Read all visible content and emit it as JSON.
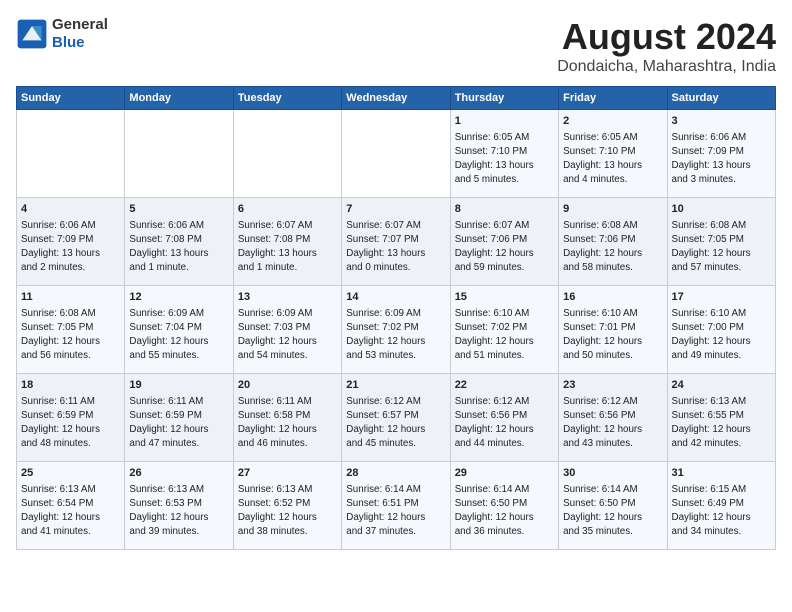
{
  "header": {
    "logo": {
      "general": "General",
      "blue": "Blue"
    },
    "title": "August 2024",
    "subtitle": "Dondaicha, Maharashtra, India"
  },
  "weekdays": [
    "Sunday",
    "Monday",
    "Tuesday",
    "Wednesday",
    "Thursday",
    "Friday",
    "Saturday"
  ],
  "weeks": [
    [
      {
        "day": "",
        "detail": ""
      },
      {
        "day": "",
        "detail": ""
      },
      {
        "day": "",
        "detail": ""
      },
      {
        "day": "",
        "detail": ""
      },
      {
        "day": "1",
        "detail": "Sunrise: 6:05 AM\nSunset: 7:10 PM\nDaylight: 13 hours\nand 5 minutes."
      },
      {
        "day": "2",
        "detail": "Sunrise: 6:05 AM\nSunset: 7:10 PM\nDaylight: 13 hours\nand 4 minutes."
      },
      {
        "day": "3",
        "detail": "Sunrise: 6:06 AM\nSunset: 7:09 PM\nDaylight: 13 hours\nand 3 minutes."
      }
    ],
    [
      {
        "day": "4",
        "detail": "Sunrise: 6:06 AM\nSunset: 7:09 PM\nDaylight: 13 hours\nand 2 minutes."
      },
      {
        "day": "5",
        "detail": "Sunrise: 6:06 AM\nSunset: 7:08 PM\nDaylight: 13 hours\nand 1 minute."
      },
      {
        "day": "6",
        "detail": "Sunrise: 6:07 AM\nSunset: 7:08 PM\nDaylight: 13 hours\nand 1 minute."
      },
      {
        "day": "7",
        "detail": "Sunrise: 6:07 AM\nSunset: 7:07 PM\nDaylight: 13 hours\nand 0 minutes."
      },
      {
        "day": "8",
        "detail": "Sunrise: 6:07 AM\nSunset: 7:06 PM\nDaylight: 12 hours\nand 59 minutes."
      },
      {
        "day": "9",
        "detail": "Sunrise: 6:08 AM\nSunset: 7:06 PM\nDaylight: 12 hours\nand 58 minutes."
      },
      {
        "day": "10",
        "detail": "Sunrise: 6:08 AM\nSunset: 7:05 PM\nDaylight: 12 hours\nand 57 minutes."
      }
    ],
    [
      {
        "day": "11",
        "detail": "Sunrise: 6:08 AM\nSunset: 7:05 PM\nDaylight: 12 hours\nand 56 minutes."
      },
      {
        "day": "12",
        "detail": "Sunrise: 6:09 AM\nSunset: 7:04 PM\nDaylight: 12 hours\nand 55 minutes."
      },
      {
        "day": "13",
        "detail": "Sunrise: 6:09 AM\nSunset: 7:03 PM\nDaylight: 12 hours\nand 54 minutes."
      },
      {
        "day": "14",
        "detail": "Sunrise: 6:09 AM\nSunset: 7:02 PM\nDaylight: 12 hours\nand 53 minutes."
      },
      {
        "day": "15",
        "detail": "Sunrise: 6:10 AM\nSunset: 7:02 PM\nDaylight: 12 hours\nand 51 minutes."
      },
      {
        "day": "16",
        "detail": "Sunrise: 6:10 AM\nSunset: 7:01 PM\nDaylight: 12 hours\nand 50 minutes."
      },
      {
        "day": "17",
        "detail": "Sunrise: 6:10 AM\nSunset: 7:00 PM\nDaylight: 12 hours\nand 49 minutes."
      }
    ],
    [
      {
        "day": "18",
        "detail": "Sunrise: 6:11 AM\nSunset: 6:59 PM\nDaylight: 12 hours\nand 48 minutes."
      },
      {
        "day": "19",
        "detail": "Sunrise: 6:11 AM\nSunset: 6:59 PM\nDaylight: 12 hours\nand 47 minutes."
      },
      {
        "day": "20",
        "detail": "Sunrise: 6:11 AM\nSunset: 6:58 PM\nDaylight: 12 hours\nand 46 minutes."
      },
      {
        "day": "21",
        "detail": "Sunrise: 6:12 AM\nSunset: 6:57 PM\nDaylight: 12 hours\nand 45 minutes."
      },
      {
        "day": "22",
        "detail": "Sunrise: 6:12 AM\nSunset: 6:56 PM\nDaylight: 12 hours\nand 44 minutes."
      },
      {
        "day": "23",
        "detail": "Sunrise: 6:12 AM\nSunset: 6:56 PM\nDaylight: 12 hours\nand 43 minutes."
      },
      {
        "day": "24",
        "detail": "Sunrise: 6:13 AM\nSunset: 6:55 PM\nDaylight: 12 hours\nand 42 minutes."
      }
    ],
    [
      {
        "day": "25",
        "detail": "Sunrise: 6:13 AM\nSunset: 6:54 PM\nDaylight: 12 hours\nand 41 minutes."
      },
      {
        "day": "26",
        "detail": "Sunrise: 6:13 AM\nSunset: 6:53 PM\nDaylight: 12 hours\nand 39 minutes."
      },
      {
        "day": "27",
        "detail": "Sunrise: 6:13 AM\nSunset: 6:52 PM\nDaylight: 12 hours\nand 38 minutes."
      },
      {
        "day": "28",
        "detail": "Sunrise: 6:14 AM\nSunset: 6:51 PM\nDaylight: 12 hours\nand 37 minutes."
      },
      {
        "day": "29",
        "detail": "Sunrise: 6:14 AM\nSunset: 6:50 PM\nDaylight: 12 hours\nand 36 minutes."
      },
      {
        "day": "30",
        "detail": "Sunrise: 6:14 AM\nSunset: 6:50 PM\nDaylight: 12 hours\nand 35 minutes."
      },
      {
        "day": "31",
        "detail": "Sunrise: 6:15 AM\nSunset: 6:49 PM\nDaylight: 12 hours\nand 34 minutes."
      }
    ]
  ]
}
